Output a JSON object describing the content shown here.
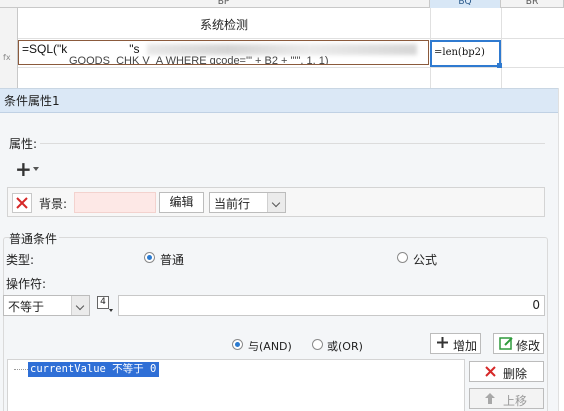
{
  "spreadsheet": {
    "columns": [
      {
        "id": "bp",
        "label": "BP"
      },
      {
        "id": "bq",
        "label": "BQ"
      },
      {
        "id": "br",
        "label": "BR"
      }
    ],
    "title_cell": "系统检测",
    "formula_line1": "=SQL(\"k",
    "formula_line1_mid": "\"s",
    "formula_line2": "GOODS_CHK V_A WHERE gcode='\" + B2 + \"'\", 1, 1)",
    "fx_marker": "fx",
    "bq_formula": "=len(bp2)"
  },
  "panel": {
    "title": "条件属性1",
    "attributes_label": "属性:",
    "background_label": "背景:",
    "edit_button": "编辑",
    "scope_select": "当前行",
    "general_condition_label": "普通条件",
    "type_label": "类型:",
    "type_options": [
      {
        "label": "普通",
        "selected": true
      },
      {
        "label": "公式",
        "selected": false
      }
    ],
    "operator_label": "操作符:",
    "operator_value": "不等于",
    "number_icon_label": "4",
    "value_field": "0",
    "logic_options": [
      {
        "label": "与(AND)",
        "selected": true
      },
      {
        "label": "或(OR)",
        "selected": false
      }
    ],
    "add_button": "增加",
    "modify_button": "修改",
    "condition_items": [
      "currentValue 不等于 0"
    ],
    "delete_button": "删除",
    "move_up_button": "上移"
  },
  "colors": {
    "selection_blue": "#2f6fd6",
    "panel_header": "#dbe8f6",
    "delete_red": "#d62828",
    "modify_green": "#2f9a3c",
    "background_swatch": "#fde8e6"
  }
}
